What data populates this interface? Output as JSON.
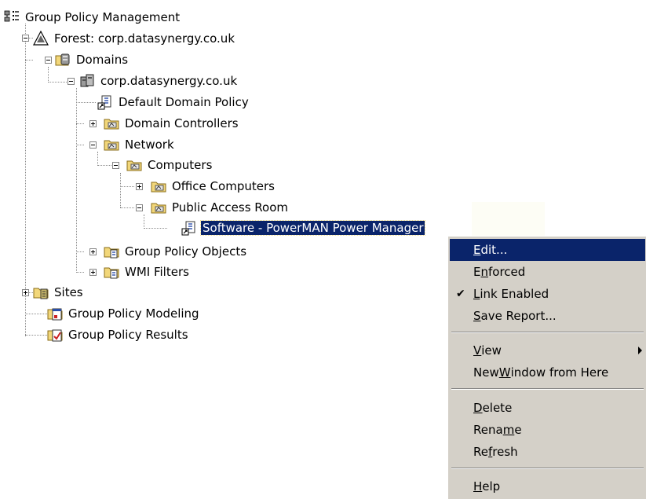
{
  "tree": {
    "root": "Group Policy Management",
    "forest": "Forest: corp.datasynergy.co.uk",
    "domains": "Domains",
    "domain": "corp.datasynergy.co.uk",
    "default_policy": "Default Domain Policy",
    "domain_controllers": "Domain Controllers",
    "network": "Network",
    "computers": "Computers",
    "office_computers": "Office Computers",
    "public_access_room": "Public Access Room",
    "software_gpo": "Software - PowerMAN Power Manager",
    "gpo_objects": "Group Policy Objects",
    "wmi_filters": "WMI Filters",
    "sites": "Sites",
    "modeling": "Group Policy Modeling",
    "results": "Group Policy Results"
  },
  "context_menu": {
    "items": [
      {
        "pre": "",
        "key": "E",
        "post": "dit..."
      },
      {
        "pre": "E",
        "key": "n",
        "post": "forced"
      },
      {
        "pre": "",
        "key": "L",
        "post": "ink Enabled"
      },
      {
        "pre": "",
        "key": "S",
        "post": "ave Report..."
      },
      {
        "pre": "",
        "key": "V",
        "post": "iew"
      },
      {
        "pre": "New ",
        "key": "W",
        "post": "indow from Here"
      },
      {
        "pre": "",
        "key": "D",
        "post": "elete"
      },
      {
        "pre": "Rena",
        "key": "m",
        "post": "e"
      },
      {
        "pre": "Re",
        "key": "f",
        "post": "resh"
      },
      {
        "pre": "",
        "key": "H",
        "post": "elp"
      }
    ],
    "checked_item": "Link Enabled",
    "highlighted_item": "Edit..."
  },
  "colors": {
    "selection": "#0a246a",
    "menu_face": "#d4d0c8"
  }
}
